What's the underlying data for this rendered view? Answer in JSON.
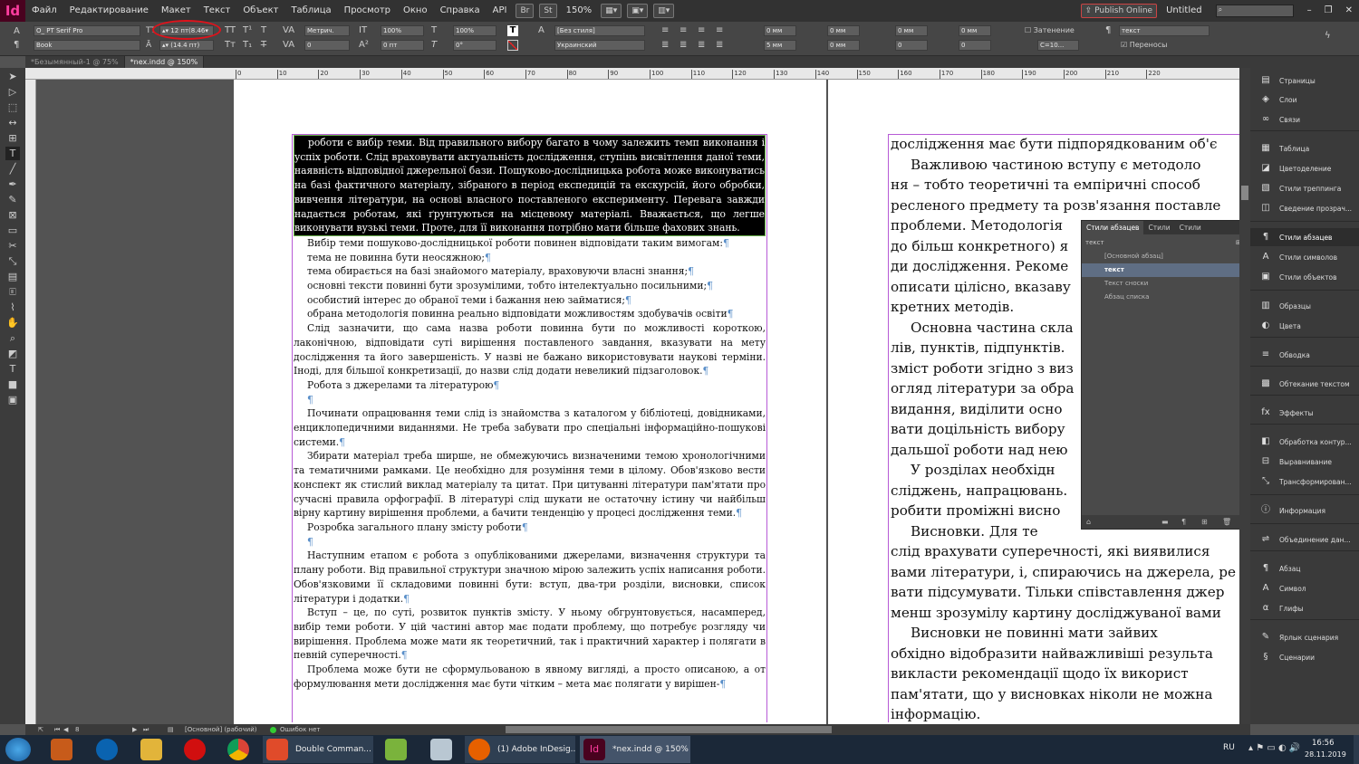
{
  "app": {
    "logo": "Id",
    "publish_label": "Publish Online",
    "doc_title": "Untitled",
    "zoom": "150%"
  },
  "menu": [
    "Файл",
    "Редактирование",
    "Макет",
    "Текст",
    "Объект",
    "Таблица",
    "Просмотр",
    "Окно",
    "Справка",
    "API"
  ],
  "control": {
    "font_family": "PT Serif Pro",
    "font_style": "Book",
    "font_size": "12 пт(8.46",
    "leading": "(14.4 пт)",
    "kerning": "Метрич.",
    "tracking": "0",
    "vscale": "100%",
    "hscale": "100%",
    "baseline": "0 пт",
    "skew": "0°",
    "char_style": "[Без стиля]",
    "language": "Украинский",
    "indent_left": "0 мм",
    "indent_right": "0 мм",
    "space_before": "0 мм",
    "space_after": "0 мм",
    "first_indent": "5 мм",
    "last_indent": "0 мм",
    "shading_label": "Затенение",
    "shading_color": "С=10...",
    "para_style": "текст",
    "hyphen_label": "Переносы"
  },
  "tabs": [
    {
      "label": "*Безымянный-1 @ 75%"
    },
    {
      "label": "*nex.indd @ 150%"
    }
  ],
  "ruler": [
    "0",
    "10",
    "20",
    "30",
    "40",
    "50",
    "60",
    "70",
    "80",
    "90",
    "100",
    "110",
    "120",
    "130",
    "140",
    "150",
    "160",
    "170",
    "180",
    "190",
    "200",
    "210",
    "220"
  ],
  "left_page": {
    "selected": "роботи є вибір теми. Від правильного вибору багато в чому залежить темп виконання і успіх роботи. Слід враховувати актуальність дослідження, ступінь висвітлення даної теми, наявність відповідної джерельної бази. Пошуково-дослідницька робота може виконуватись на базі фактичного матеріалу, зібраного в період експедицій та екскурсій, його обробки, вивчення літератури, на основі власного поставленого експерименту. Перевага завжди надається роботам, які ґрунтуються на місцевому матеріалі. Вважається, що легше виконувати вузькі теми. Проте, для її виконання потрібно мати більше фахових знань.",
    "paragraphs": [
      "Вибір теми пошуково-дослідницької роботи повинен відповідати таким вимогам:",
      "тема не повинна бути неосяжною;",
      "тема обирається на базі знайомого матеріалу, враховуючи власні знання;",
      "основні тексти повинні бути зрозумілими, тобто інтелектуально посильними;",
      "особистий інтерес до обраної теми і бажання нею займатися;",
      "обрана методологія повинна реально відповідати можливостям здобувачів освіти",
      "Слід зазначити, що сама назва роботи повинна бути по можливості короткою, лаконічною, відповідати суті вирішення поставленого завдання, вказувати на мету дослідження та його завершеність. У назві не бажано використовувати наукові терміни. Іноді, для більшої конкретизації, до назви слід додати невеликий підзаголовок.",
      "Робота з джерелами та літературою",
      "",
      "Починати опрацювання теми слід із знайомства з каталогом у бібліотеці, довідниками, енциклопедичними виданнями. Не треба забувати про спеціальні інформаційно-пошукові системи.",
      "Збирати матеріал треба ширше, не обмежуючись визначеними темою хронологічними та тематичними рамками. Це необхідно для розуміння теми в цілому. Обов'язково вести конспект як стислий виклад матеріалу та цитат. При цитуванні літератури пам'ятати про сучасні правила орфографії. В літературі слід шукати не остаточну істину чи найбільш вірну картину вирішення проблеми, а бачити тенденцію у процесі дослідження теми.",
      "Розробка загального плану змісту роботи",
      "",
      "Наступним етапом є робота з опублікованими джерелами, визначення структури та плану роботи. Від правильної структури значною мірою залежить успіх написання роботи. Обов'язковими її складовими повинні бути: вступ, два-три розділи, висновки, список літератури і додатки.",
      "Вступ – це, по суті, розвиток пунктів змісту. У ньому обгрунтовується, насамперед, вибір теми роботи. У цій частині автор має подати проблему, що потребує розгляду чи вирішення. Проблема може мати як теоретичний, так і практичний характер і полягати в певній суперечності.",
      "Проблема може бути не сформульованою в явному вигляді, а просто описаною, а от формулювання мети дослідження має бути чітким – мета має полягати у вирішен-"
    ]
  },
  "right_page": {
    "lines": [
      "дослідження має бути підпорядкованим об'є",
      "Важливою частиною вступу є методоло",
      "ня – тобто теоретичні та емпіричні способ",
      "ресленого предмету та розв'язання поставле",
      "проблеми. Методологія",
      "до більш конкретного) я",
      "ди дослідження. Рекоме",
      "описати цілісно, вказаву",
      "кретних методів.",
      "Основна частина скла",
      "лів, пунктів, підпунктів.",
      "зміст роботи згідно з виз",
      "огляд літератури за обра",
      "видання, виділити осно",
      "вати доцільність вибору",
      "дальшої роботи над нею",
      "У розділах необхідн",
      "сліджень, напрацювань.",
      "робити проміжні висно",
      "Висновки. Для те",
      "слід врахувати суперечності, які виявилися",
      "вами літератури, і, спираючись на джерела, ре",
      "вати підсумувати. Тільки співставлення джер",
      "менш зрозумілу картину досліджуваної вами",
      "Висновки не повинні мати зайвих",
      "обхідно відобразити найважливіші результа",
      "викласти рекомендації щодо їх використ",
      "пам'ятати, що у висновках ніколи не можна",
      "інформацію."
    ]
  },
  "style_panel": {
    "tabs": [
      "Стили абзацев",
      "Стили",
      "Стили"
    ],
    "search": "текст",
    "rows": [
      "[Основной абзац]",
      "текст",
      "Текст сноски",
      "Абзац списка"
    ]
  },
  "right_panel": [
    {
      "label": "Страницы",
      "icon": "pages-icon"
    },
    {
      "label": "Слои",
      "icon": "layers-icon"
    },
    {
      "label": "Связи",
      "icon": "links-icon"
    },
    {
      "label": "Таблица",
      "icon": "table-icon"
    },
    {
      "label": "Цветоделение",
      "icon": "separations-icon"
    },
    {
      "label": "Стили треппинга",
      "icon": "trap-icon"
    },
    {
      "label": "Сведение прозрач...",
      "icon": "flattener-icon"
    },
    {
      "label": "Стили абзацев",
      "icon": "para-styles-icon"
    },
    {
      "label": "Стили символов",
      "icon": "char-styles-icon"
    },
    {
      "label": "Стили объектов",
      "icon": "obj-styles-icon"
    },
    {
      "label": "Образцы",
      "icon": "swatches-icon"
    },
    {
      "label": "Цвета",
      "icon": "color-icon"
    },
    {
      "label": "Обводка",
      "icon": "stroke-icon"
    },
    {
      "label": "Обтекание текстом",
      "icon": "textwrap-icon"
    },
    {
      "label": "Эффекты",
      "icon": "fx-icon"
    },
    {
      "label": "Обработка контур...",
      "icon": "pathfinder-icon"
    },
    {
      "label": "Выравнивание",
      "icon": "align-icon"
    },
    {
      "label": "Трансформирован...",
      "icon": "transform-icon"
    },
    {
      "label": "Информация",
      "icon": "info-icon"
    },
    {
      "label": "Объединение дан...",
      "icon": "datamerge-icon"
    },
    {
      "label": "Абзац",
      "icon": "paragraph-icon"
    },
    {
      "label": "Символ",
      "icon": "character-icon"
    },
    {
      "label": "Глифы",
      "icon": "glyphs-icon"
    },
    {
      "label": "Ярлык сценария",
      "icon": "script-label-icon"
    },
    {
      "label": "Сценарии",
      "icon": "scripts-icon"
    }
  ],
  "status": {
    "page": "8",
    "master": "[Основной] (рабочий)",
    "errors": "Ошибок нет"
  },
  "taskbar": {
    "items": [
      "Double Comman...",
      "(1) Adobe InDesig...",
      "*nex.indd @ 150%"
    ],
    "lang": "RU",
    "time": "16:56",
    "date": "28.11.2019"
  },
  "colors": {
    "selection": "#000000",
    "frame": "#b75bd6",
    "highlight_circle": "#e0121b",
    "taskbar": "#1b2838"
  }
}
